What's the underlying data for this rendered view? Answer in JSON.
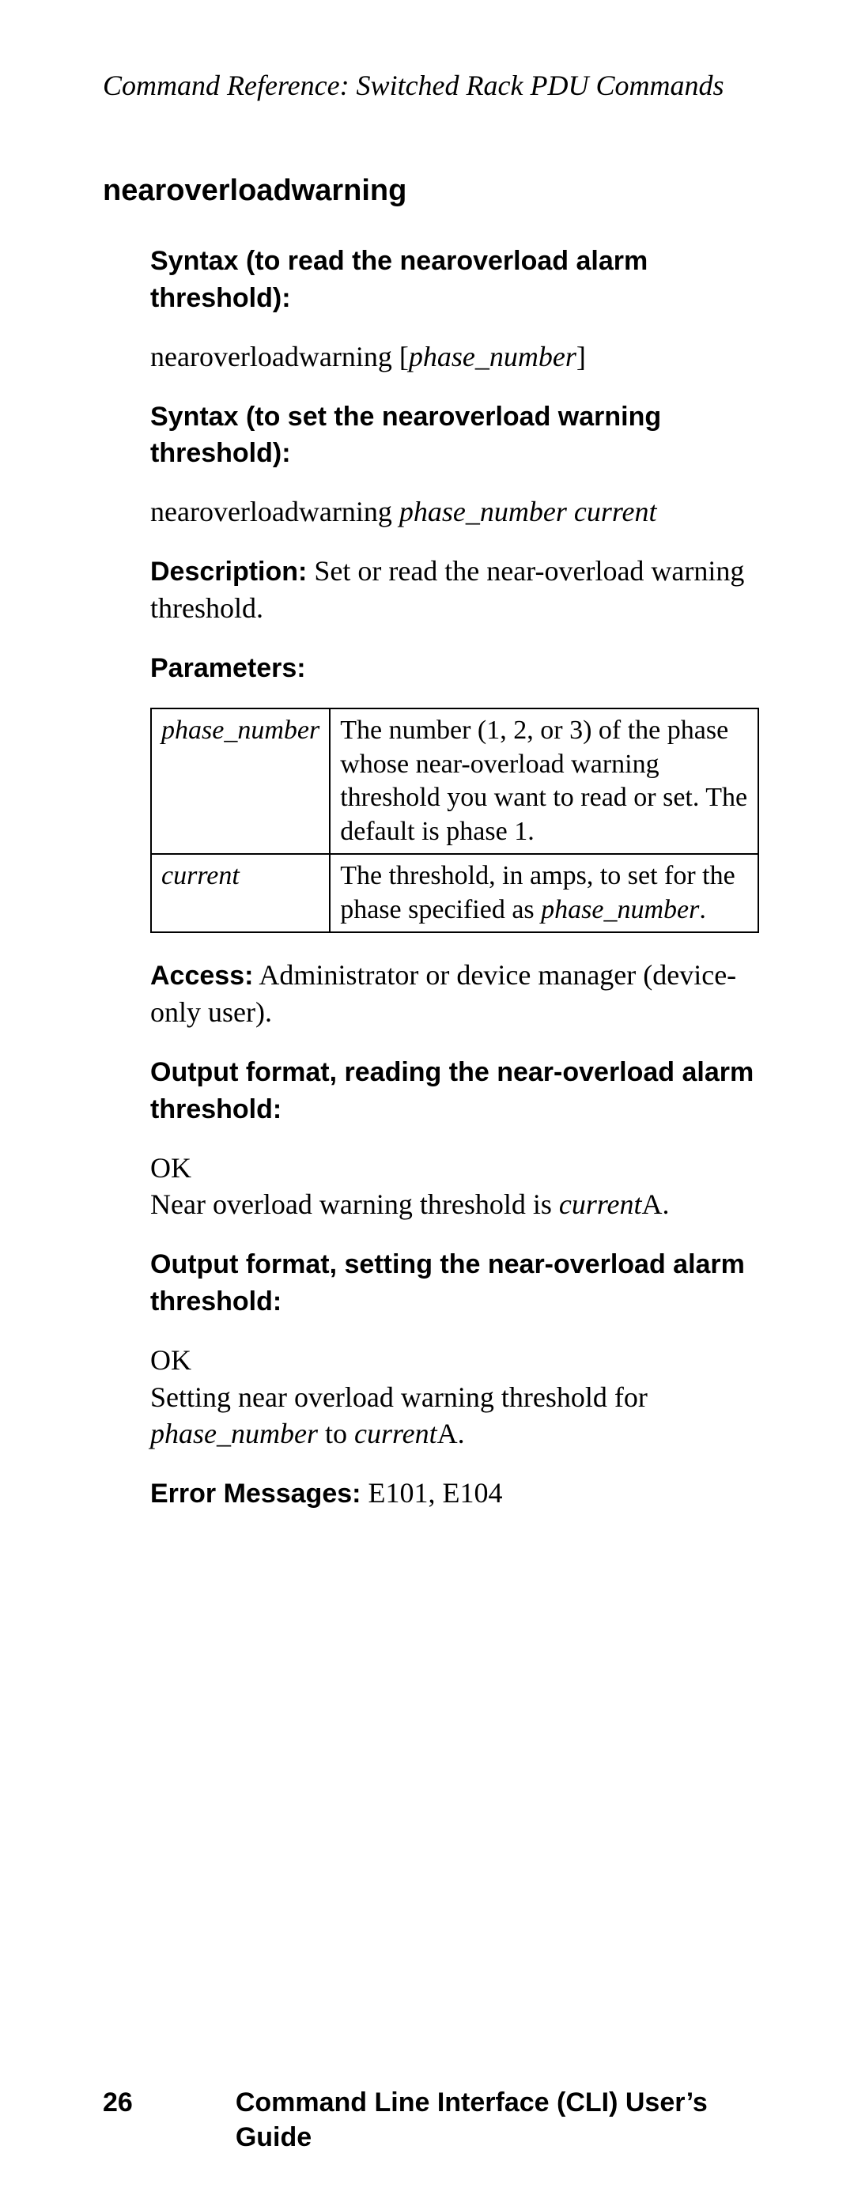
{
  "header": "Command Reference: Switched Rack PDU Commands",
  "section": "nearoverloadwarning",
  "syntax_read_label": "Syntax (to read the nearoverload alarm threshold):",
  "syntax_read_cmd_prefix": "nearoverloadwarning [",
  "syntax_read_cmd_param": "phase_number",
  "syntax_read_cmd_suffix": "]",
  "syntax_set_label": "Syntax (to set the nearoverload warning threshold):",
  "syntax_set_cmd_prefix": "nearoverloadwarning ",
  "syntax_set_cmd_param1": "phase_number",
  "syntax_set_cmd_sep": " ",
  "syntax_set_cmd_param2": "current",
  "description_label": "Description:",
  "description_text": " Set or read the near-overload warning threshold.",
  "parameters_label": "Parameters:",
  "params": {
    "row1_name": "phase_number",
    "row1_desc": "The number (1, 2, or 3) of the phase whose near-overload warning threshold you want to read or set. The default is phase 1.",
    "row2_name": "current",
    "row2_desc_prefix": "The threshold, in amps, to set for the phase specified as ",
    "row2_desc_italic": "phase_number",
    "row2_desc_suffix": "."
  },
  "access_label": "Access:",
  "access_text": " Administrator or device manager (device-only user).",
  "output_read_label": "Output format, reading the near-overload alarm threshold:",
  "output_read_line1": "OK",
  "output_read_line2_prefix": "Near overload warning threshold is ",
  "output_read_line2_italic": "current",
  "output_read_line2_suffix": "A.",
  "output_set_label": "Output format, setting the near-overload alarm threshold:",
  "output_set_line1": "OK",
  "output_set_line2_prefix": "Setting near overload warning threshold for ",
  "output_set_line2_italic1": "phase_number",
  "output_set_line2_mid": " to ",
  "output_set_line2_italic2": "current",
  "output_set_line2_suffix": "A.",
  "errors_label": "Error Messages:",
  "errors_text": " E101, E104",
  "page_number": "26",
  "footer_title": "Command Line Interface (CLI) User’s Guide"
}
